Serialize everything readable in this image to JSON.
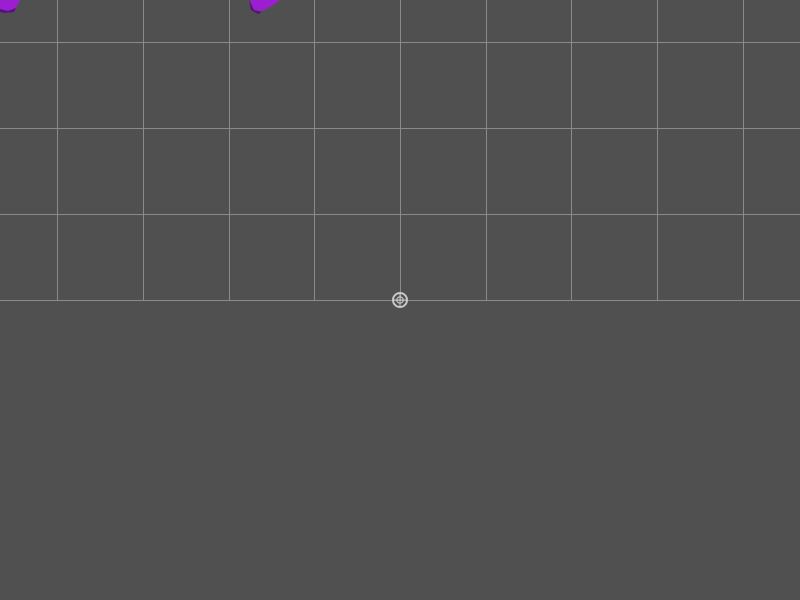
{
  "viewport": {
    "background_color": "#505050",
    "grid": {
      "visible": true,
      "line_color": "#8a8a8a"
    },
    "objects": [
      {
        "name": "purple-object-left",
        "color": "#9b1fd0",
        "shade_color": "#5a0f80"
      },
      {
        "name": "purple-object-center",
        "color": "#9b1fd0",
        "shade_color": "#5a0f80"
      }
    ],
    "pivot_gizmo": {
      "icon": "pivot-crosshair-icon",
      "color": "#c8c8c8"
    }
  }
}
